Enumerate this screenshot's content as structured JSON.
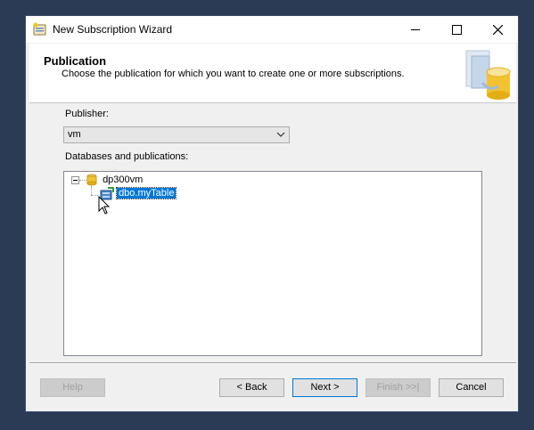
{
  "window": {
    "title": "New Subscription Wizard",
    "controls": {
      "minimize": "—",
      "maximize": "☐",
      "close": "✕"
    }
  },
  "header": {
    "title": "Publication",
    "subtitle": "Choose the publication for which you want to create one or more subscriptions."
  },
  "publisher": {
    "label": "Publisher:",
    "value": "vm"
  },
  "tree": {
    "label": "Databases and publications:",
    "database": {
      "expander": "⊟",
      "name": "dp300vm"
    },
    "publication": {
      "name": "dbo.myTable"
    }
  },
  "buttons": {
    "help": "Help",
    "back": "< Back",
    "next": "Next >",
    "finish": "Finish >>|",
    "cancel": "Cancel"
  },
  "icons": {
    "app": "wizard-icon",
    "database": "database-icon",
    "publication": "publication-icon",
    "dropdown": "chevron-down-icon",
    "header": "replication-graphic-icon"
  },
  "colors": {
    "selection": "#0078d7",
    "desktop": "#2b3a55"
  }
}
